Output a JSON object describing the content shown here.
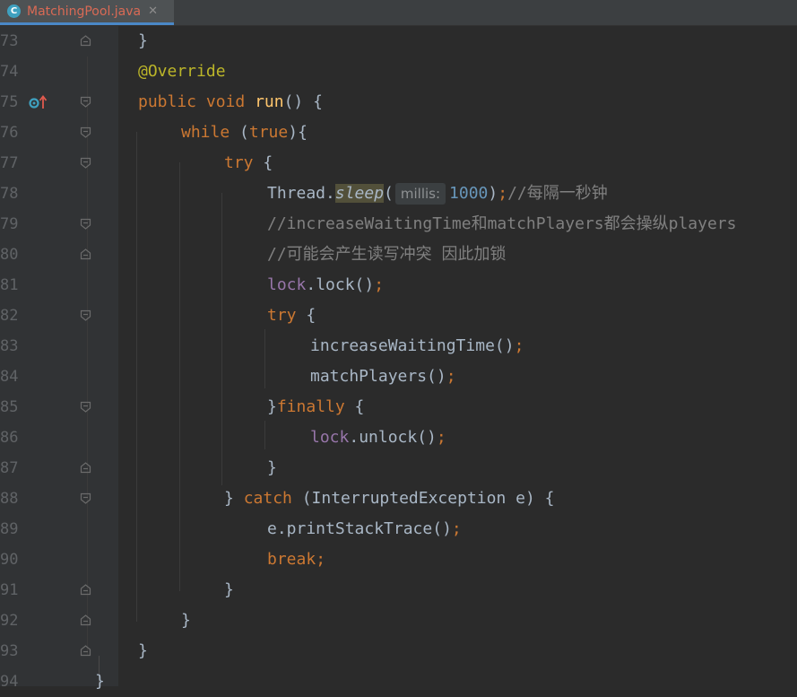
{
  "tab": {
    "icon_letter": "C",
    "filename": "MatchingPool.java",
    "close_glyph": "✕"
  },
  "colors": {
    "keyword": "#cc7832",
    "annotation": "#bbb529",
    "method_decl": "#ffc66d",
    "number": "#6897bb",
    "comment": "#808080",
    "field": "#9876aa",
    "text": "#a9b7c6"
  },
  "lines": [
    {
      "n": "73",
      "fold": "up"
    },
    {
      "n": "74",
      "fold": "none"
    },
    {
      "n": "75",
      "fold": "down",
      "gutter_icon": "override-marker-icon"
    },
    {
      "n": "76",
      "fold": "down"
    },
    {
      "n": "77",
      "fold": "down"
    },
    {
      "n": "78",
      "fold": "none"
    },
    {
      "n": "79",
      "fold": "down"
    },
    {
      "n": "80",
      "fold": "up"
    },
    {
      "n": "81",
      "fold": "none"
    },
    {
      "n": "82",
      "fold": "down"
    },
    {
      "n": "83",
      "fold": "none"
    },
    {
      "n": "84",
      "fold": "none"
    },
    {
      "n": "85",
      "fold": "down"
    },
    {
      "n": "86",
      "fold": "none"
    },
    {
      "n": "87",
      "fold": "up"
    },
    {
      "n": "88",
      "fold": "down"
    },
    {
      "n": "89",
      "fold": "none"
    },
    {
      "n": "90",
      "fold": "none"
    },
    {
      "n": "91",
      "fold": "up"
    },
    {
      "n": "92",
      "fold": "up"
    },
    {
      "n": "93",
      "fold": "up"
    },
    {
      "n": "94",
      "fold": "none"
    }
  ],
  "code": {
    "l73": {
      "t1": "}"
    },
    "l74": {
      "ann": "@Override"
    },
    "l75": {
      "kw1": "public",
      "sp1": " ",
      "kw2": "void",
      "sp2": " ",
      "fn": "run",
      "t1": "() {"
    },
    "l76": {
      "kw1": "while",
      "t1": " (",
      "kw2": "true",
      "t2": "){"
    },
    "l77": {
      "kw1": "try",
      "t1": " {"
    },
    "l78": {
      "t1": "Thread.",
      "call": "sleep",
      "t2": "(",
      "hint": "millis:",
      "num": "1000",
      "t3": ")",
      "semi": ";",
      "cm": "//每隔一秒钟"
    },
    "l79": {
      "cm": "//increaseWaitingTime和matchPlayers都会操纵players"
    },
    "l80": {
      "cm": "//可能会产生读写冲突 因此加锁"
    },
    "l81": {
      "field": "lock",
      "t1": ".lock()",
      "semi": ";"
    },
    "l82": {
      "kw1": "try",
      "t1": " {"
    },
    "l83": {
      "t1": "increaseWaitingTime()",
      "semi": ";"
    },
    "l84": {
      "t1": "matchPlayers()",
      "semi": ";"
    },
    "l85": {
      "t1": "}",
      "kw1": "finally",
      "t2": " {"
    },
    "l86": {
      "field": "lock",
      "t1": ".unlock()",
      "semi": ";"
    },
    "l87": {
      "t1": "}"
    },
    "l88": {
      "t1": "} ",
      "kw1": "catch",
      "t2": " (InterruptedException e) {"
    },
    "l89": {
      "t1": "e.printStackTrace()",
      "semi": ";"
    },
    "l90": {
      "kw1": "break",
      "semi": ";"
    },
    "l91": {
      "t1": "}"
    },
    "l92": {
      "t1": "}"
    },
    "l93": {
      "t1": "}"
    },
    "l94": {
      "t1": "}"
    }
  }
}
